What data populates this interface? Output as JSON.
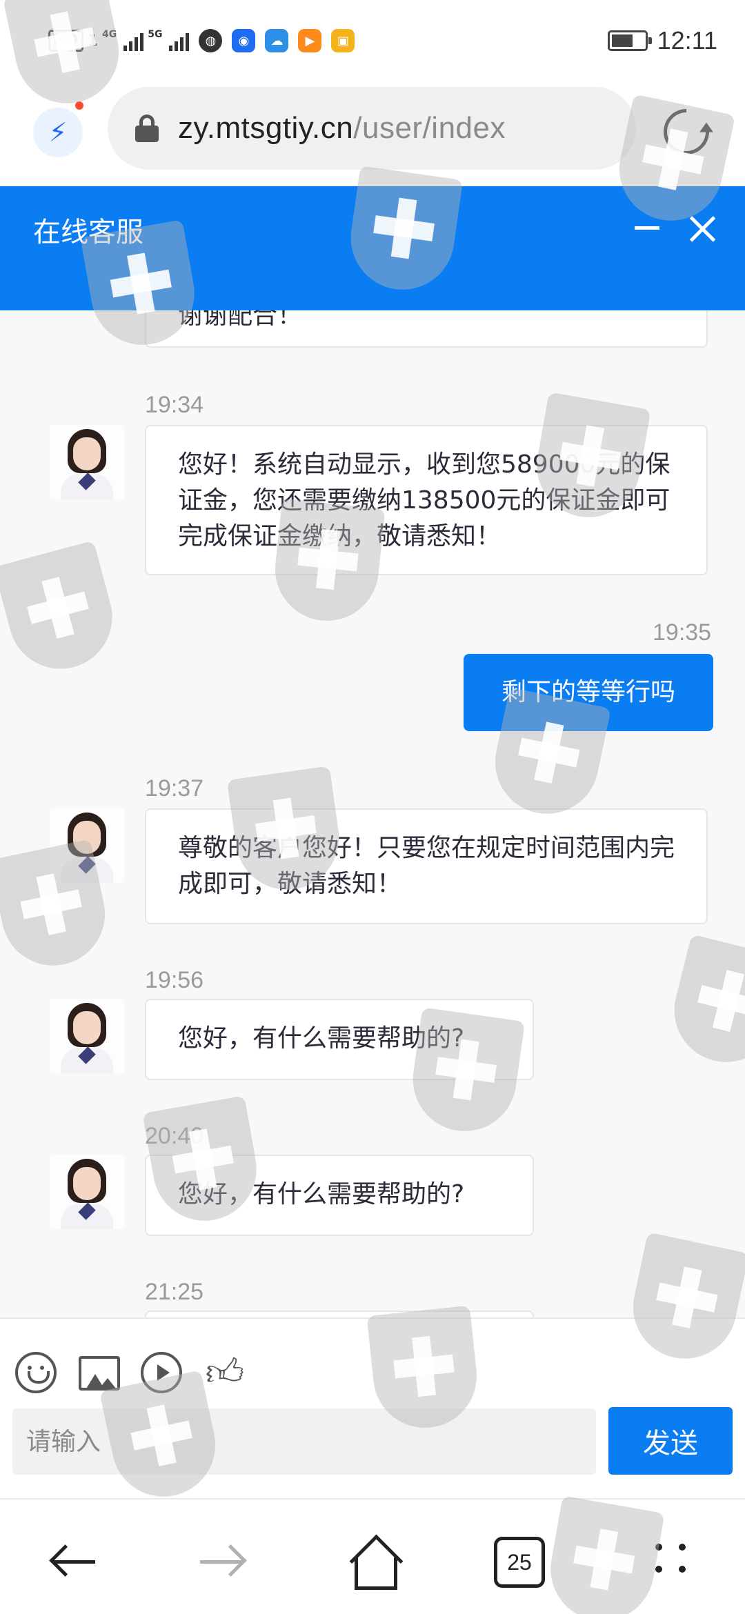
{
  "status_bar": {
    "hd_badge": "HD",
    "sim1": "1",
    "net1": "4G",
    "net2": "5G",
    "time": "12:11",
    "app_icons": [
      "globe-icon",
      "bulb-icon",
      "cloud-icon",
      "play-icon",
      "box-icon"
    ]
  },
  "browser": {
    "url_host": "zy.mtsgtiy.cn",
    "url_path": "/user/index",
    "tab_count": "25"
  },
  "chat": {
    "title": "在线客服",
    "partial_top_text": "谢谢配合！",
    "messages": [
      {
        "time": "19:34",
        "direction": "in",
        "text": "您好！系统自动显示，收到您589000元的保证金，您还需要缴纳138500元的保证金即可完成保证金缴纳，敬请悉知！"
      },
      {
        "time": "19:35",
        "direction": "out",
        "text": "剩下的等等行吗"
      },
      {
        "time": "19:37",
        "direction": "in",
        "text": "尊敬的客户您好！只要您在规定时间范围内完成即可，敬请悉知！"
      },
      {
        "time": "19:56",
        "direction": "in",
        "text": "您好，有什么需要帮助的?"
      },
      {
        "time": "20:40",
        "direction": "in",
        "text": "您好，有什么需要帮助的?"
      },
      {
        "time": "21:25",
        "direction": "in",
        "text": ""
      }
    ]
  },
  "composer": {
    "placeholder": "请输入",
    "send_label": "发送",
    "tools": [
      "emoji-icon",
      "image-icon",
      "video-icon",
      "thumbs-up-icon"
    ]
  },
  "colors": {
    "accent": "#0a7df2",
    "chat_bg": "#f8f8f8",
    "timestamp": "#9a9a9a"
  }
}
